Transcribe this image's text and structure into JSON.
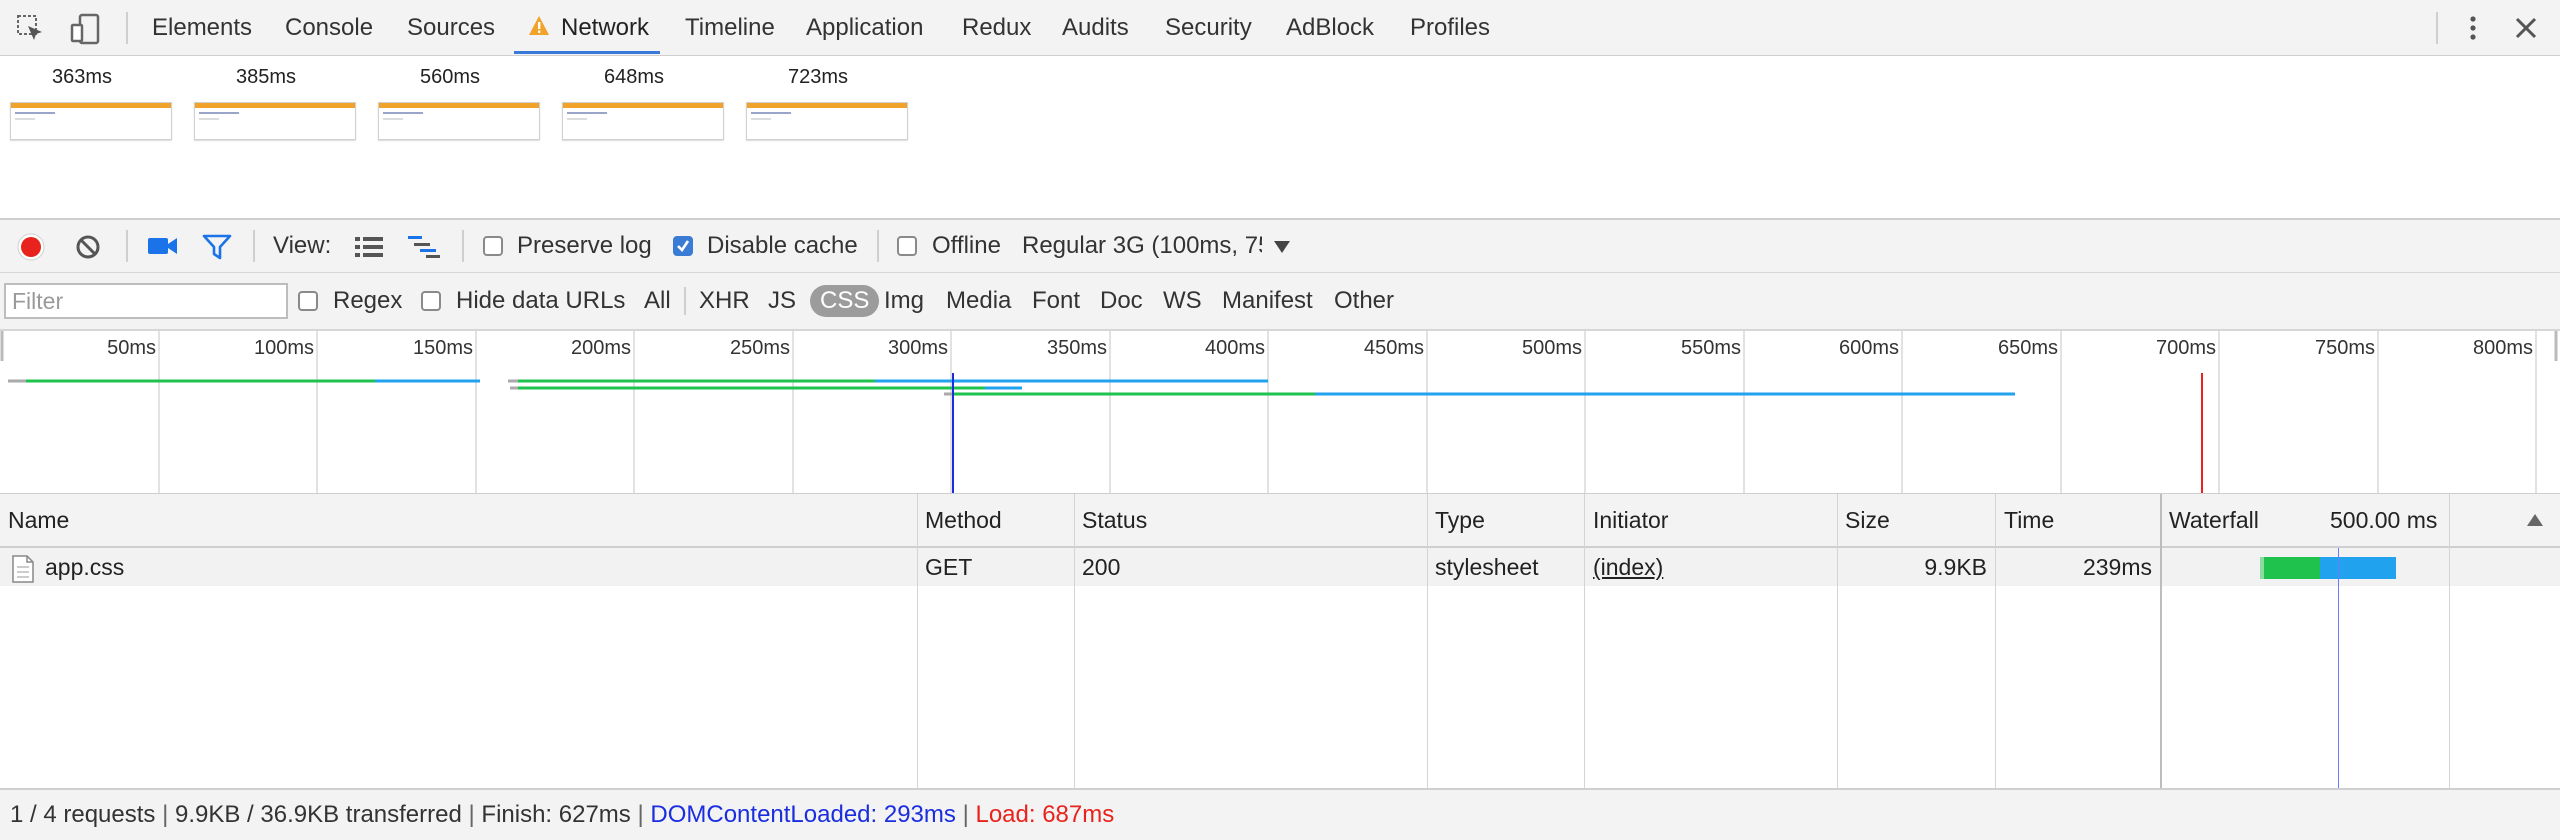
{
  "tabs": [
    {
      "label": "Elements"
    },
    {
      "label": "Console"
    },
    {
      "label": "Sources"
    },
    {
      "label": "Network"
    },
    {
      "label": "Timeline"
    },
    {
      "label": "Application"
    },
    {
      "label": "Redux"
    },
    {
      "label": "Audits"
    },
    {
      "label": "Security"
    },
    {
      "label": "AdBlock"
    },
    {
      "label": "Profiles"
    }
  ],
  "active_tab": "Network",
  "filmstrip": [
    "363ms",
    "385ms",
    "560ms",
    "648ms",
    "723ms"
  ],
  "toolbar": {
    "view_label": "View:",
    "preserve_log": {
      "label": "Preserve log",
      "checked": false
    },
    "disable_cache": {
      "label": "Disable cache",
      "checked": true
    },
    "offline": {
      "label": "Offline",
      "checked": false
    },
    "throttle": "Regular 3G (100ms, 75"
  },
  "filterbar": {
    "placeholder": "Filter",
    "regex": {
      "label": "Regex",
      "checked": false
    },
    "hide_data_urls": {
      "label": "Hide data URLs",
      "checked": false
    },
    "all": "All",
    "types": [
      "XHR",
      "JS",
      "CSS",
      "Img",
      "Media",
      "Font",
      "Doc",
      "WS",
      "Manifest",
      "Other"
    ],
    "active_type": "CSS"
  },
  "overview_ticks": [
    "50ms",
    "100ms",
    "150ms",
    "200ms",
    "250ms",
    "300ms",
    "350ms",
    "400ms",
    "450ms",
    "500ms",
    "550ms",
    "600ms",
    "650ms",
    "700ms",
    "750ms",
    "800ms"
  ],
  "table": {
    "columns": {
      "name": "Name",
      "method": "Method",
      "status": "Status",
      "type": "Type",
      "initiator": "Initiator",
      "size": "Size",
      "time": "Time",
      "waterfall": "Waterfall",
      "waterfall_scale": "500.00 ms"
    },
    "rows": [
      {
        "name": "app.css",
        "method": "GET",
        "status": "200",
        "type": "stylesheet",
        "initiator": "(index)",
        "size": "9.9KB",
        "time": "239ms"
      }
    ]
  },
  "status": {
    "requests": "1 / 4 requests",
    "transferred": "9.9KB / 36.9KB transferred",
    "finish": "Finish: 627ms",
    "dom_content_loaded": "DOMContentLoaded: 293ms",
    "load": "Load: 687ms"
  },
  "colors": {
    "accent": "#3879d9",
    "warning": "#f1a22b",
    "record": "#e8231d",
    "waiting_green": "#1fc24d",
    "download_blue": "#21a2ee",
    "dom_line": "#1a2ee0",
    "load_line": "#e8231d"
  }
}
